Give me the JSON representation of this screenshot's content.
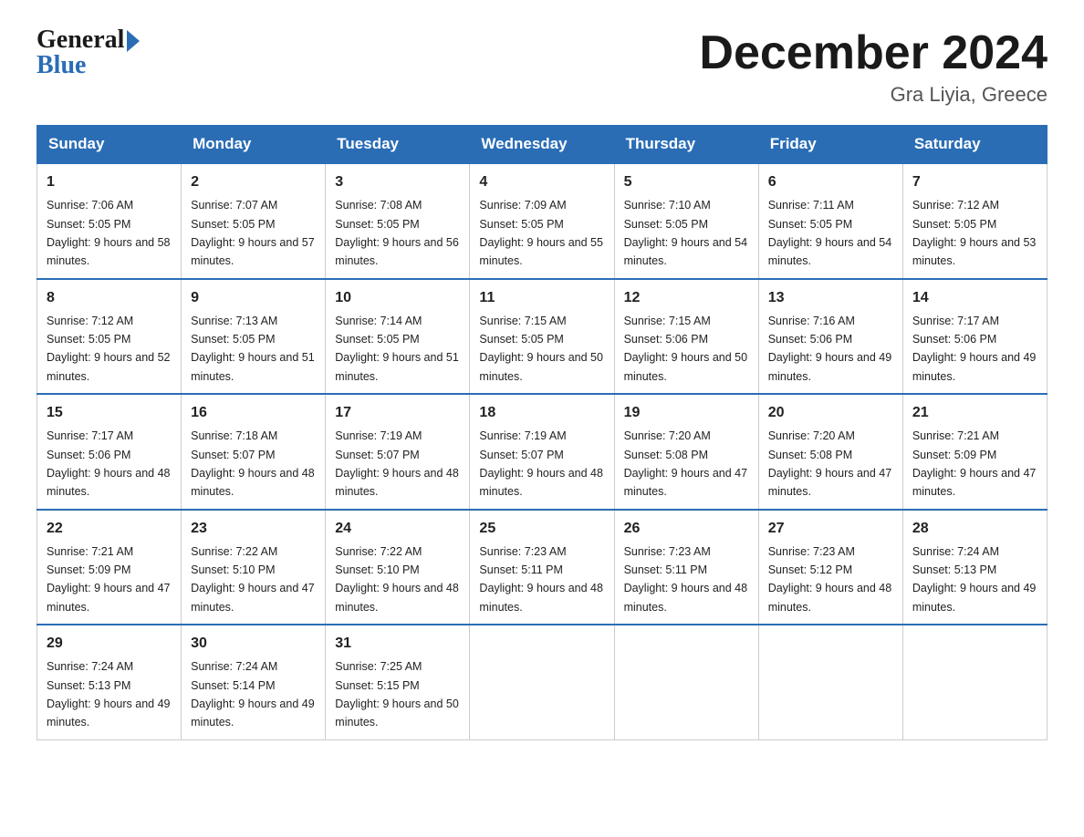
{
  "logo": {
    "general": "General",
    "blue": "Blue"
  },
  "title": "December 2024",
  "location": "Gra Liyia, Greece",
  "days_header": [
    "Sunday",
    "Monday",
    "Tuesday",
    "Wednesday",
    "Thursday",
    "Friday",
    "Saturday"
  ],
  "weeks": [
    [
      {
        "day": "1",
        "sunrise": "7:06 AM",
        "sunset": "5:05 PM",
        "daylight": "9 hours and 58 minutes."
      },
      {
        "day": "2",
        "sunrise": "7:07 AM",
        "sunset": "5:05 PM",
        "daylight": "9 hours and 57 minutes."
      },
      {
        "day": "3",
        "sunrise": "7:08 AM",
        "sunset": "5:05 PM",
        "daylight": "9 hours and 56 minutes."
      },
      {
        "day": "4",
        "sunrise": "7:09 AM",
        "sunset": "5:05 PM",
        "daylight": "9 hours and 55 minutes."
      },
      {
        "day": "5",
        "sunrise": "7:10 AM",
        "sunset": "5:05 PM",
        "daylight": "9 hours and 54 minutes."
      },
      {
        "day": "6",
        "sunrise": "7:11 AM",
        "sunset": "5:05 PM",
        "daylight": "9 hours and 54 minutes."
      },
      {
        "day": "7",
        "sunrise": "7:12 AM",
        "sunset": "5:05 PM",
        "daylight": "9 hours and 53 minutes."
      }
    ],
    [
      {
        "day": "8",
        "sunrise": "7:12 AM",
        "sunset": "5:05 PM",
        "daylight": "9 hours and 52 minutes."
      },
      {
        "day": "9",
        "sunrise": "7:13 AM",
        "sunset": "5:05 PM",
        "daylight": "9 hours and 51 minutes."
      },
      {
        "day": "10",
        "sunrise": "7:14 AM",
        "sunset": "5:05 PM",
        "daylight": "9 hours and 51 minutes."
      },
      {
        "day": "11",
        "sunrise": "7:15 AM",
        "sunset": "5:05 PM",
        "daylight": "9 hours and 50 minutes."
      },
      {
        "day": "12",
        "sunrise": "7:15 AM",
        "sunset": "5:06 PM",
        "daylight": "9 hours and 50 minutes."
      },
      {
        "day": "13",
        "sunrise": "7:16 AM",
        "sunset": "5:06 PM",
        "daylight": "9 hours and 49 minutes."
      },
      {
        "day": "14",
        "sunrise": "7:17 AM",
        "sunset": "5:06 PM",
        "daylight": "9 hours and 49 minutes."
      }
    ],
    [
      {
        "day": "15",
        "sunrise": "7:17 AM",
        "sunset": "5:06 PM",
        "daylight": "9 hours and 48 minutes."
      },
      {
        "day": "16",
        "sunrise": "7:18 AM",
        "sunset": "5:07 PM",
        "daylight": "9 hours and 48 minutes."
      },
      {
        "day": "17",
        "sunrise": "7:19 AM",
        "sunset": "5:07 PM",
        "daylight": "9 hours and 48 minutes."
      },
      {
        "day": "18",
        "sunrise": "7:19 AM",
        "sunset": "5:07 PM",
        "daylight": "9 hours and 48 minutes."
      },
      {
        "day": "19",
        "sunrise": "7:20 AM",
        "sunset": "5:08 PM",
        "daylight": "9 hours and 47 minutes."
      },
      {
        "day": "20",
        "sunrise": "7:20 AM",
        "sunset": "5:08 PM",
        "daylight": "9 hours and 47 minutes."
      },
      {
        "day": "21",
        "sunrise": "7:21 AM",
        "sunset": "5:09 PM",
        "daylight": "9 hours and 47 minutes."
      }
    ],
    [
      {
        "day": "22",
        "sunrise": "7:21 AM",
        "sunset": "5:09 PM",
        "daylight": "9 hours and 47 minutes."
      },
      {
        "day": "23",
        "sunrise": "7:22 AM",
        "sunset": "5:10 PM",
        "daylight": "9 hours and 47 minutes."
      },
      {
        "day": "24",
        "sunrise": "7:22 AM",
        "sunset": "5:10 PM",
        "daylight": "9 hours and 48 minutes."
      },
      {
        "day": "25",
        "sunrise": "7:23 AM",
        "sunset": "5:11 PM",
        "daylight": "9 hours and 48 minutes."
      },
      {
        "day": "26",
        "sunrise": "7:23 AM",
        "sunset": "5:11 PM",
        "daylight": "9 hours and 48 minutes."
      },
      {
        "day": "27",
        "sunrise": "7:23 AM",
        "sunset": "5:12 PM",
        "daylight": "9 hours and 48 minutes."
      },
      {
        "day": "28",
        "sunrise": "7:24 AM",
        "sunset": "5:13 PM",
        "daylight": "9 hours and 49 minutes."
      }
    ],
    [
      {
        "day": "29",
        "sunrise": "7:24 AM",
        "sunset": "5:13 PM",
        "daylight": "9 hours and 49 minutes."
      },
      {
        "day": "30",
        "sunrise": "7:24 AM",
        "sunset": "5:14 PM",
        "daylight": "9 hours and 49 minutes."
      },
      {
        "day": "31",
        "sunrise": "7:25 AM",
        "sunset": "5:15 PM",
        "daylight": "9 hours and 50 minutes."
      },
      null,
      null,
      null,
      null
    ]
  ]
}
